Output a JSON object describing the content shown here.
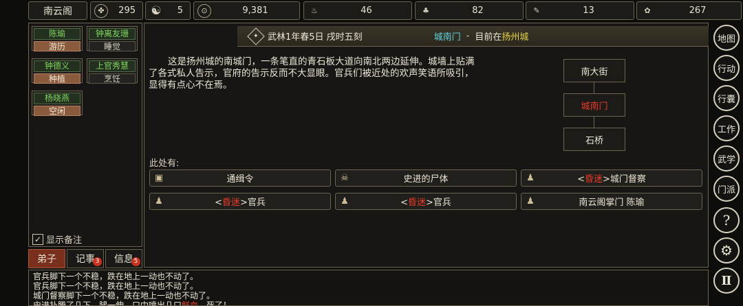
{
  "topbar": {
    "location": "南云阁",
    "stats": [
      {
        "icon": "gourd-icon",
        "glyph": "☯",
        "value": "295"
      },
      {
        "icon": "taiji-icon",
        "glyph": "☯",
        "value": "5"
      },
      {
        "icon": "coin-icon",
        "glyph": "◎",
        "value": "9,381"
      },
      {
        "icon": "food-icon",
        "glyph": "♨",
        "value": "46"
      },
      {
        "icon": "herb-icon",
        "glyph": "♣",
        "value": "82"
      },
      {
        "icon": "scroll-icon",
        "glyph": "✎",
        "value": "13"
      },
      {
        "icon": "material-icon",
        "glyph": "✿",
        "value": "267"
      }
    ]
  },
  "disciples": [
    {
      "name": "陈瑜",
      "status": "游历",
      "busy": true
    },
    {
      "name": "钟离友珊",
      "status": "睡觉",
      "busy": false
    },
    {
      "name": "钟德义",
      "status": "种植",
      "busy": true
    },
    {
      "name": "上官秀慧",
      "status": "烹饪",
      "busy": false
    },
    {
      "name": "杨晓燕",
      "status": "空闲",
      "busy": true
    }
  ],
  "show_notes": "显示备注",
  "left_tabs": [
    {
      "label": "弟子",
      "badge": ""
    },
    {
      "label": "记事",
      "badge": "3"
    },
    {
      "label": "信息",
      "badge": "5"
    }
  ],
  "location_header": {
    "date": "武林1年春5日 戌时五刻",
    "place": "城南门",
    "separator": "-",
    "now_in": "目前在",
    "city": "扬州城"
  },
  "description": "这是扬州城的南城门，一条笔直的青石板大道向南北两边延伸。城墙上贴满了各式私人告示，官府的告示反而不大显眼。官兵们被近处的欢声笑语所吸引，显得有点心不在焉。",
  "map": {
    "north": "南大街",
    "current": "城南门",
    "south": "石桥"
  },
  "here_label": "此处有:",
  "entities": [
    {
      "icon": "box-icon",
      "glyph": "▣",
      "prefix": "",
      "tag": "",
      "suffix": "通缉令"
    },
    {
      "icon": "skull-icon",
      "glyph": "☠",
      "prefix": "",
      "tag": "",
      "suffix": "史进的尸体"
    },
    {
      "icon": "person-icon",
      "glyph": "♟",
      "prefix": "<",
      "tag": "昏迷",
      "suffix": ">城门督察"
    },
    {
      "icon": "person-icon",
      "glyph": "♟",
      "prefix": "<",
      "tag": "昏迷",
      "suffix": ">官兵"
    },
    {
      "icon": "person-icon",
      "glyph": "♟",
      "prefix": "<",
      "tag": "昏迷",
      "suffix": ">官兵"
    },
    {
      "icon": "person-icon",
      "glyph": "♟",
      "prefix": "",
      "tag": "",
      "suffix": "南云阁掌门 陈瑜"
    }
  ],
  "sidebar": [
    {
      "name": "map-button",
      "label": "地图"
    },
    {
      "name": "action-button",
      "label": "行动"
    },
    {
      "name": "bag-button",
      "label": "行囊"
    },
    {
      "name": "work-button",
      "label": "工作"
    },
    {
      "name": "martial-button",
      "label": "武学"
    },
    {
      "name": "sect-button",
      "label": "门派"
    },
    {
      "name": "help-button",
      "label": "?"
    },
    {
      "name": "settings-button",
      "label": "⚙"
    },
    {
      "name": "pause-button",
      "label": "Ⅱ"
    }
  ],
  "log": [
    {
      "pre": "官兵脚下一个不稳，跌在地上一动也不动了。",
      "red": "",
      "post": ""
    },
    {
      "pre": "官兵脚下一个不稳，跌在地上一动也不动了。",
      "red": "",
      "post": ""
    },
    {
      "pre": "城门督察脚下一个不稳，跌在地上一动也不动了。",
      "red": "",
      "post": ""
    },
    {
      "pre": "史进扑腾了几下，腿一伸，口中喷出几口",
      "red": "鲜血",
      "post": "，死了！"
    }
  ],
  "colors": {
    "accent_green": "#7fd65f",
    "busy_status": "#8a5a3c",
    "coma_red": "#ef3b2a",
    "place_cyan": "#5fd3e0",
    "city_yellow": "#e8d24a",
    "active_tab": "#7a2e1c"
  }
}
